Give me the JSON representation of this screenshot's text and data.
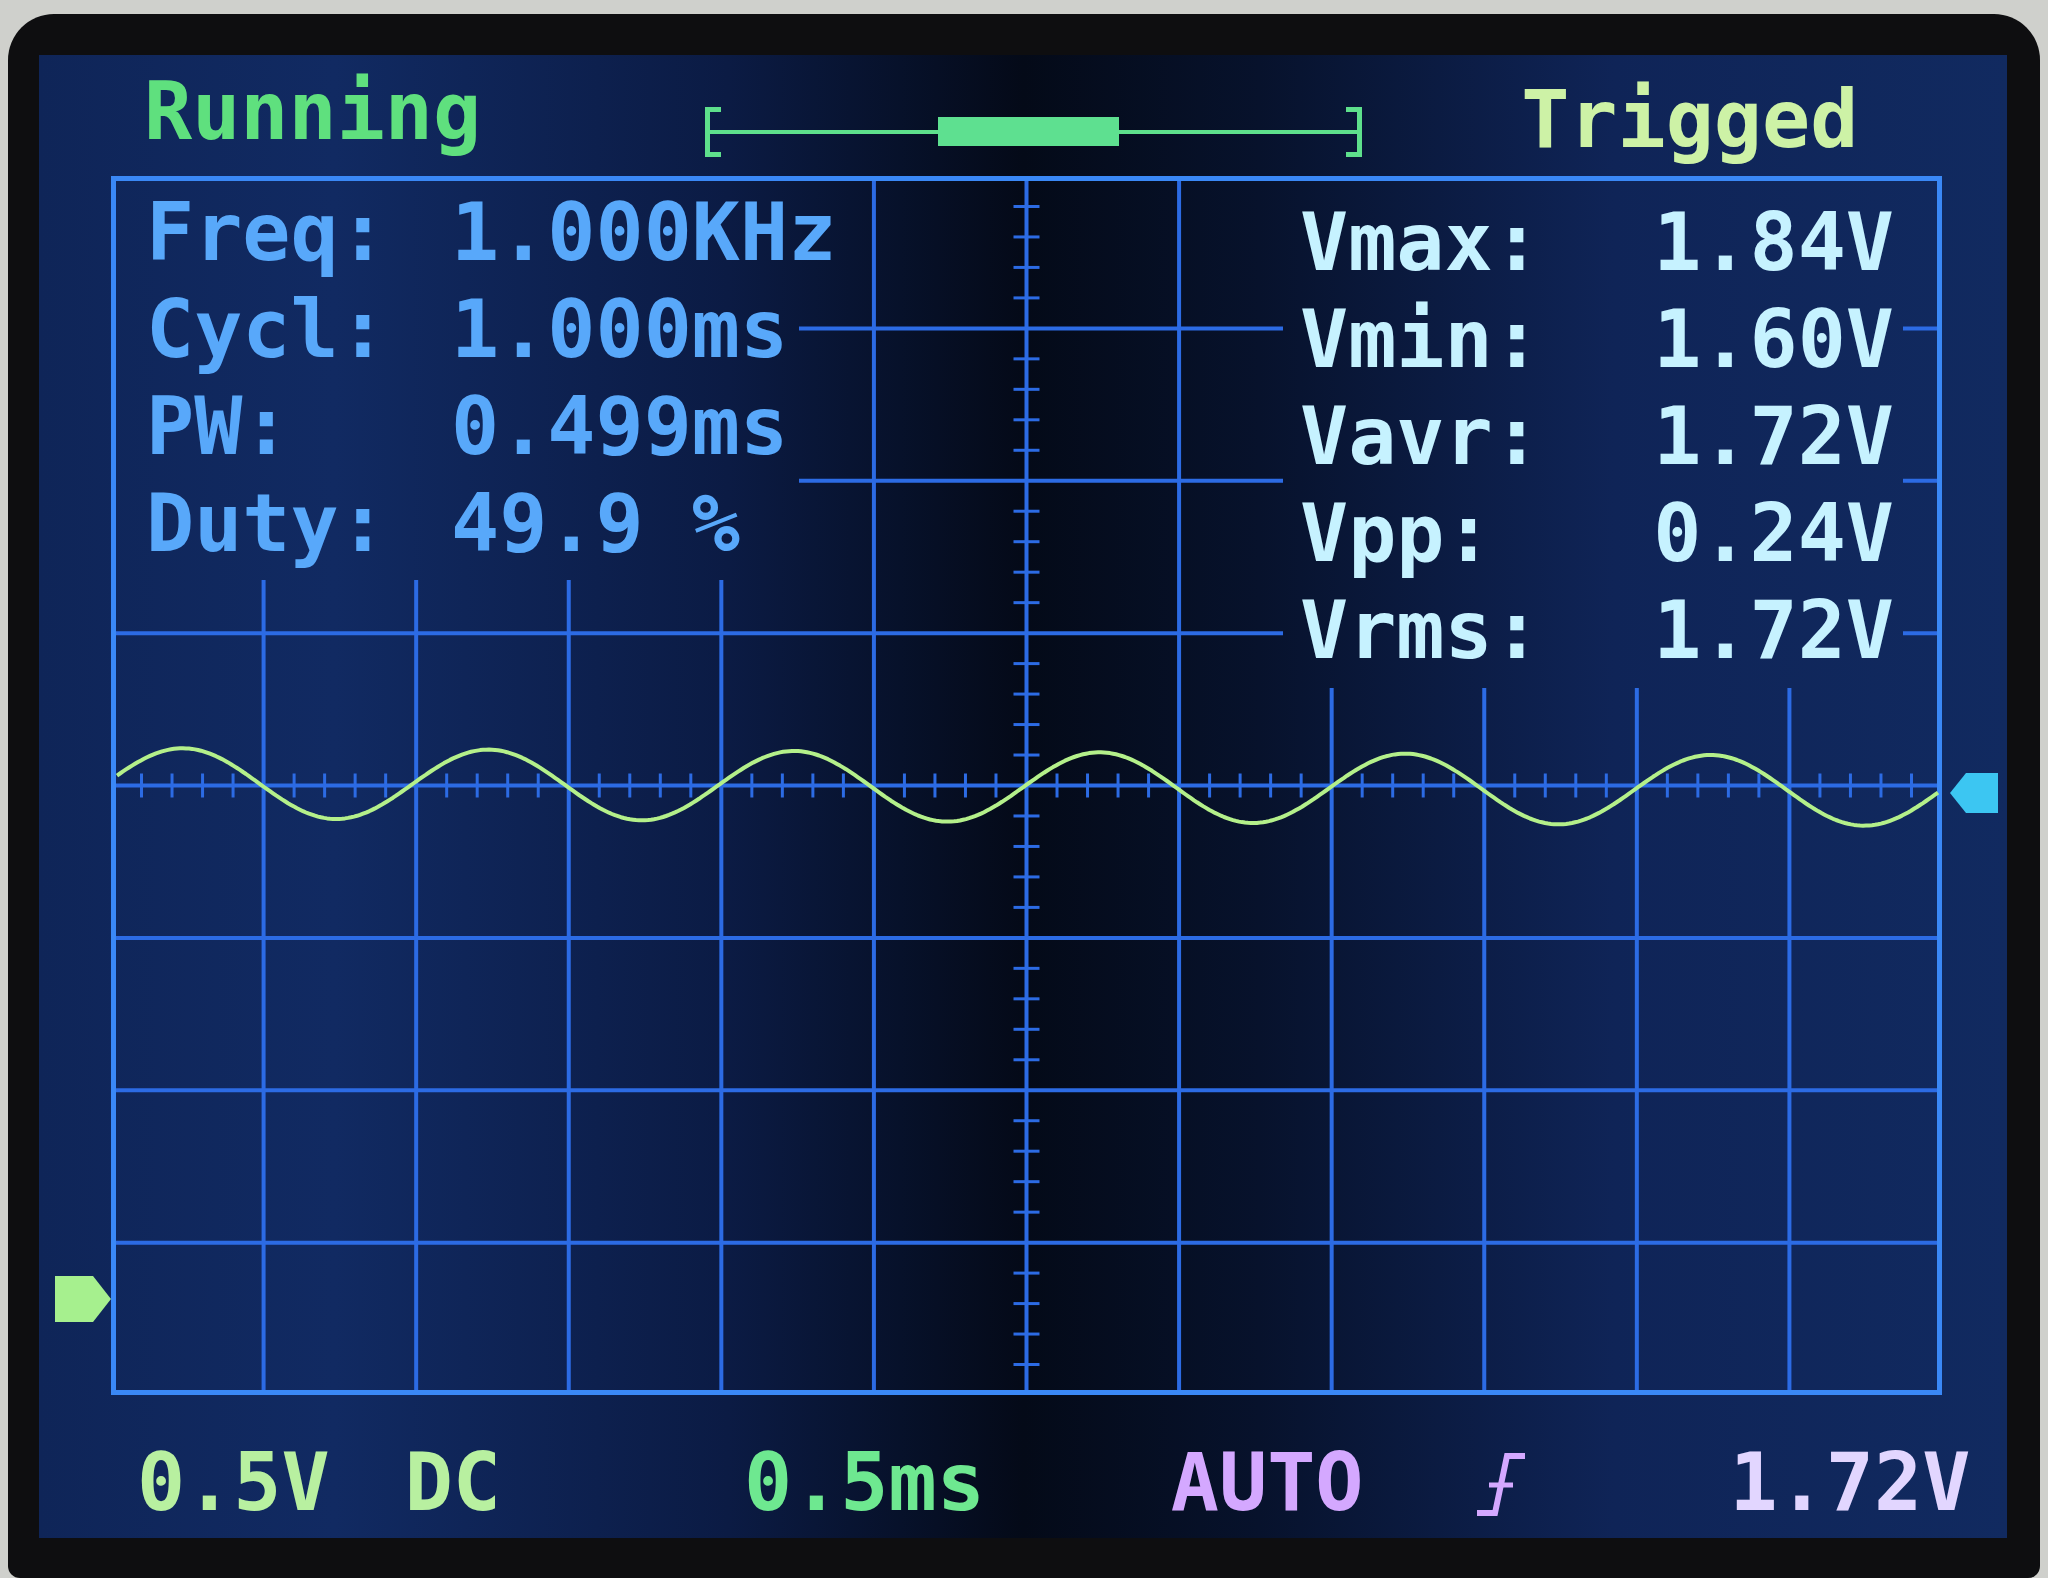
{
  "status": {
    "run_state": "Running",
    "trigger_state": "Trigged"
  },
  "measurements": {
    "timing": [
      {
        "label": "Freq:",
        "value": "1.000KHz"
      },
      {
        "label": "Cycl:",
        "value": "1.000ms"
      },
      {
        "label": "PW:",
        "value": "0.499ms"
      },
      {
        "label": "Duty:",
        "value": "49.9 %"
      }
    ],
    "voltage": [
      {
        "label": "Vmax:",
        "value": "1.84V"
      },
      {
        "label": "Vmin:",
        "value": "1.60V"
      },
      {
        "label": "Vavr:",
        "value": "1.72V"
      },
      {
        "label": "Vpp:",
        "value": "0.24V"
      },
      {
        "label": "Vrms:",
        "value": "1.72V"
      }
    ]
  },
  "settings": {
    "volts_per_div": "0.5V",
    "coupling": "DC",
    "time_per_div": "0.5ms",
    "trigger_mode": "AUTO",
    "rising_edge": true,
    "trigger_level": "1.72V"
  }
}
